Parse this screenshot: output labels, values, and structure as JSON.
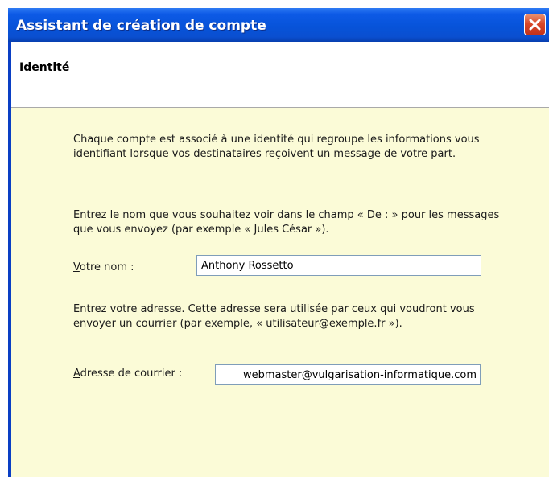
{
  "window": {
    "title": "Assistant de création de compte"
  },
  "header": {
    "title": "Identité"
  },
  "content": {
    "intro": "Chaque compte est associé à une identité qui regroupe les informations vous identifiant lorsque vos destinataires reçoivent un message de votre part.",
    "name_instruction": "Entrez le nom que vous souhaitez voir dans le champ « De : » pour les messages que vous envoyez (par exemple « Jules César »).",
    "name_label_accel": "V",
    "name_label_rest": "otre nom :",
    "name_value": "Anthony Rossetto",
    "email_instruction": "Entrez votre adresse. Cette adresse sera utilisée par ceux qui voudront vous envoyer un courrier (par exemple, « utilisateur@exemple.fr »).",
    "email_label_accel": "A",
    "email_label_rest": "dresse de courrier :",
    "email_value": "webmaster@vulgarisation-informatique.com"
  },
  "colors": {
    "titlebar": "#0753d9",
    "content_background": "#fbfbd7",
    "close_button": "#d9492a"
  }
}
